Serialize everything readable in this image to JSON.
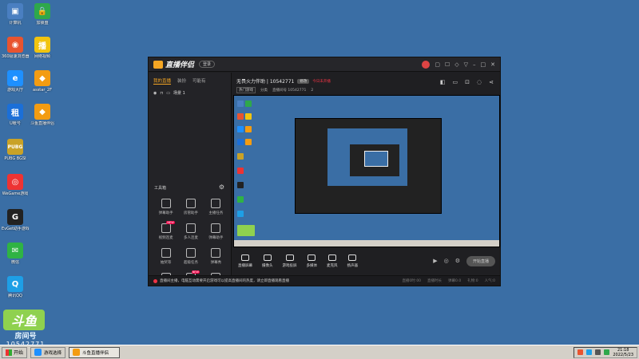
{
  "desktop": {
    "icons": [
      {
        "label": "计算机",
        "glyph": "▣",
        "color": "#4a7fc1"
      },
      {
        "label": "加锁盘",
        "glyph": "🔒",
        "color": "#2ea84b"
      },
      {
        "label": "360极速浏览器",
        "glyph": "◉",
        "color": "#e8542f"
      },
      {
        "label": "网络视频",
        "glyph": "播",
        "color": "#f1c40f"
      },
      {
        "label": "游戏大厅",
        "glyph": "e",
        "color": "#1e90ff"
      },
      {
        "label": "asstar_2F",
        "glyph": "◆",
        "color": "#f39c12"
      },
      {
        "label": "U帐号",
        "glyph": "租",
        "color": "#1b6fd8"
      },
      {
        "label": "斗鱼直播伴侣",
        "glyph": "◆",
        "color": "#f39c12"
      },
      {
        "label": "PUBG BGSI",
        "glyph": "PUBG",
        "color": "#c9a227"
      },
      {
        "label": "WeGame游戏",
        "glyph": "◎",
        "color": "#e33"
      },
      {
        "label": "EvGet助手游戏",
        "glyph": "G",
        "color": "#222"
      },
      {
        "label": "微信",
        "glyph": "✉",
        "color": "#2fb344"
      },
      {
        "label": "腾讯QQ",
        "glyph": "Q",
        "color": "#1e9fe6"
      }
    ],
    "logo": {
      "main": "斗鱼",
      "sub": "房间号",
      "number": "10542771"
    }
  },
  "window": {
    "brand": "直播伴侣",
    "version": "登录",
    "left_panel": {
      "tabs": [
        "我的直播",
        "装扮",
        "可能有"
      ],
      "scene_label": "场景 1",
      "toolbox_title": "工具箱",
      "tools": [
        {
          "label": "弹幕助手",
          "badge": ""
        },
        {
          "label": "房管助手",
          "badge": ""
        },
        {
          "label": "主播任务",
          "badge": ""
        },
        {
          "label": "视频连麦",
          "badge": "NEW"
        },
        {
          "label": "多人连麦",
          "badge": ""
        },
        {
          "label": "弹幕助手",
          "badge": ""
        },
        {
          "label": "抽奖等",
          "badge": ""
        },
        {
          "label": "超级任务",
          "badge": ""
        },
        {
          "label": "弹幕秀",
          "badge": ""
        },
        {
          "label": "",
          "badge": ""
        },
        {
          "label": "",
          "badge": "NEW"
        },
        {
          "label": "",
          "badge": ""
        }
      ]
    },
    "header": {
      "title": "无畏火力伴助 | 10542771",
      "tag": "修改",
      "warning": "今日未开播",
      "row2": [
        "热门游戏",
        "分类",
        "直播间号 10542771",
        "2"
      ]
    },
    "controls": [
      "直播屏幕",
      "摄像头",
      "游戏投屏",
      "多媒体",
      "麦克风",
      "扬声器"
    ],
    "start_label": "开始直播",
    "status_text": "直播间主播，电脑互动需要开启游戏可以提高直播间的热度，请立即直播观看直播",
    "stats": [
      "直播0时:00",
      "直播时长",
      "弹幕0.0",
      "礼物:0",
      "人气:0"
    ]
  },
  "taskbar": {
    "start": "开始",
    "tasks": [
      {
        "label": "游戏选择",
        "color": "#1e90ff"
      },
      {
        "label": "斗鱼直播伴侣",
        "color": "#f39c12"
      }
    ],
    "time": "21:18",
    "date": "2022/5/23"
  }
}
